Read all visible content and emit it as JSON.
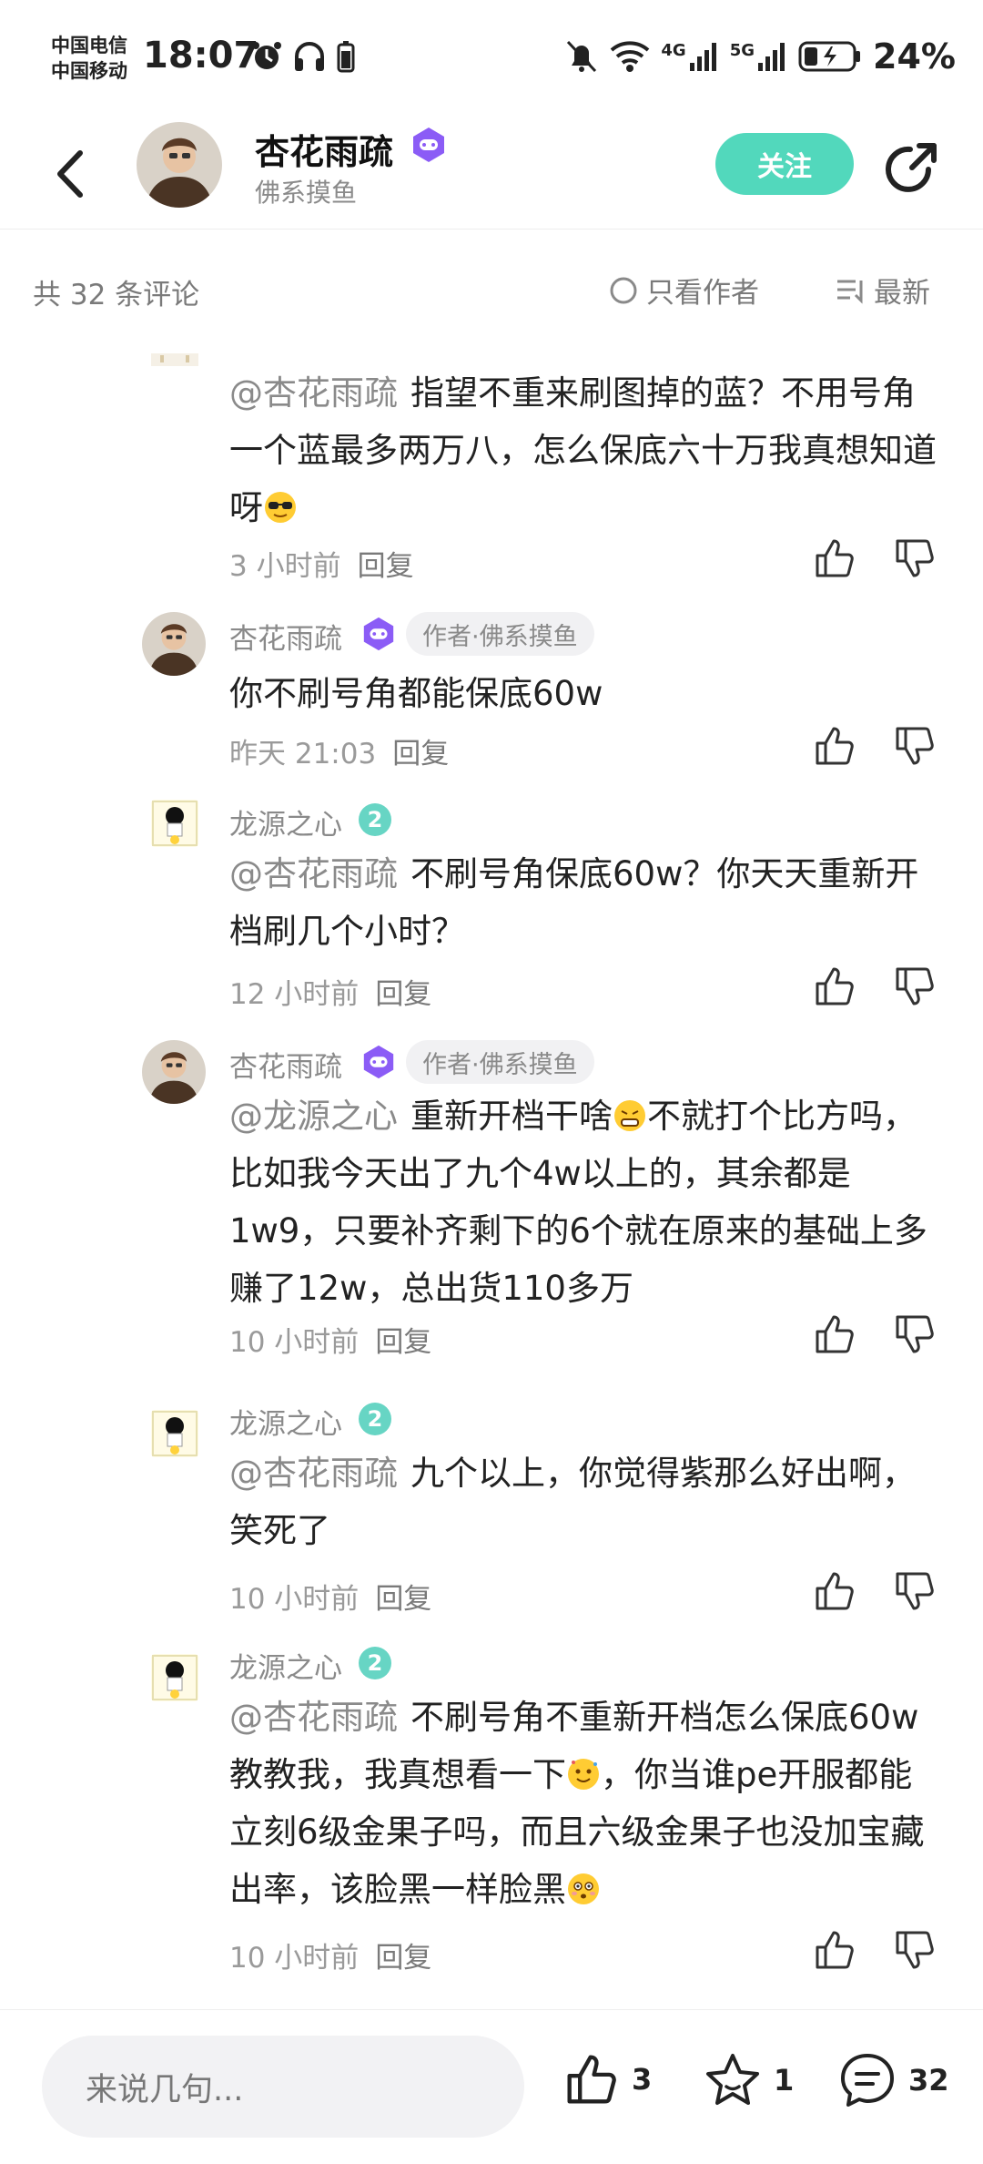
{
  "status_bar": {
    "carrier1": "中国电信",
    "carrier2": "中国移动",
    "time": "18:07",
    "net1": "4G",
    "net2": "5G",
    "battery": "24%"
  },
  "header": {
    "name": "杏花雨疏",
    "subtitle": "佛系摸鱼",
    "follow_label": "关注"
  },
  "comment_bar": {
    "count_text": "共 32 条评论",
    "only_author_label": "只看作者",
    "sort_label": "最新"
  },
  "replies": [
    {
      "mention": "@杏花雨疏",
      "text": "指望不重来刷图掉的蓝？不用号角一个蓝最多两万八，怎么保底六十万我真想知道呀",
      "time": "3 小时前",
      "reply_label": "回复"
    },
    {
      "name": "杏花雨疏",
      "tag": "作者·佛系摸鱼",
      "text": "你不刷号角都能保底60w",
      "time": "昨天 21:03",
      "reply_label": "回复"
    },
    {
      "name": "龙源之心",
      "mention": "@杏花雨疏",
      "text": "不刷号角保底60w？你天天重新开档刷几个小时？",
      "time": "12 小时前",
      "reply_label": "回复"
    },
    {
      "name": "杏花雨疏",
      "tag": "作者·佛系摸鱼",
      "mention": "@龙源之心",
      "text_a": "重新开档干啥",
      "text_b": "不就打个比方吗，比如我今天出了九个4w以上的，其余都是1w9，只要补齐剩下的6个就在原来的基础上多赚了12w，总出货110多万",
      "time": "10 小时前",
      "reply_label": "回复"
    },
    {
      "name": "龙源之心",
      "mention": "@杏花雨疏",
      "text": "九个以上，你觉得紫那么好出啊，笑死了",
      "time": "10 小时前",
      "reply_label": "回复"
    },
    {
      "name": "龙源之心",
      "mention": "@杏花雨疏",
      "text_a": "不刷号角不重新开档怎么保底60w教教我，我真想看一下",
      "text_b": "，你当谁pe开服都能立刻6级金果子吗，而且六级金果子也没加宝藏出率，该脸黑一样脸黑",
      "time": "10 小时前",
      "reply_label": "回复"
    }
  ],
  "bottom_bar": {
    "input_placeholder": "来说几句...",
    "like_count": "3",
    "star_count": "1",
    "comment_count": "32"
  },
  "colors": {
    "accent": "#52d8bc",
    "badge_purple": "#8b5cf6",
    "level_badge": "#67d5c4"
  }
}
